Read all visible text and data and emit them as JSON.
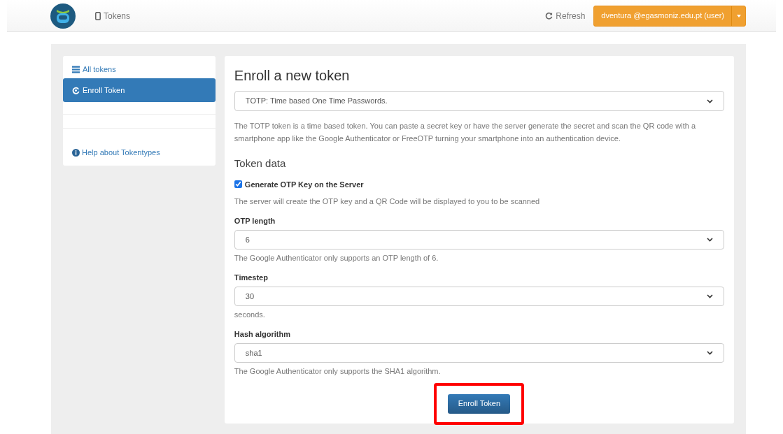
{
  "navbar": {
    "nav_link": "Tokens",
    "refresh": "Refresh",
    "user_button": "dventura @egasmoniz.edu.pt (user)"
  },
  "sidebar": {
    "items": [
      {
        "label": "All tokens",
        "kind": "list",
        "selected": false
      },
      {
        "label": "Enroll Token",
        "kind": "enroll",
        "selected": true
      }
    ],
    "help_link": "Help about Tokentypes"
  },
  "form": {
    "title": "Enroll a new token",
    "token_type": "TOTP: Time based One Time Passwords.",
    "description": "The TOTP token is a time based token. You can paste a secret key or have the server generate the secret and scan the QR code with a smartphone app like the Google Authenticator or FreeOTP turning your smartphone into an authentication device.",
    "section": "Token data",
    "fields": [
      {
        "kind": "checkbox",
        "label": "Generate OTP Key on the Server",
        "checked": true,
        "help": "The server will create the OTP key and a QR Code will be displayed to you to be scanned"
      },
      {
        "kind": "select",
        "label": "OTP length",
        "value": "6",
        "help": "The Google Authenticator only supports an OTP length of 6."
      },
      {
        "kind": "select",
        "label": "Timestep",
        "value": "30",
        "help": "seconds."
      },
      {
        "kind": "select",
        "label": "Hash algorithm",
        "value": "sha1",
        "help": "The Google Authenticator only supports the SHA1 algorithm."
      }
    ],
    "enroll_button": {
      "label": "Enroll Token",
      "highlighted": true
    }
  }
}
